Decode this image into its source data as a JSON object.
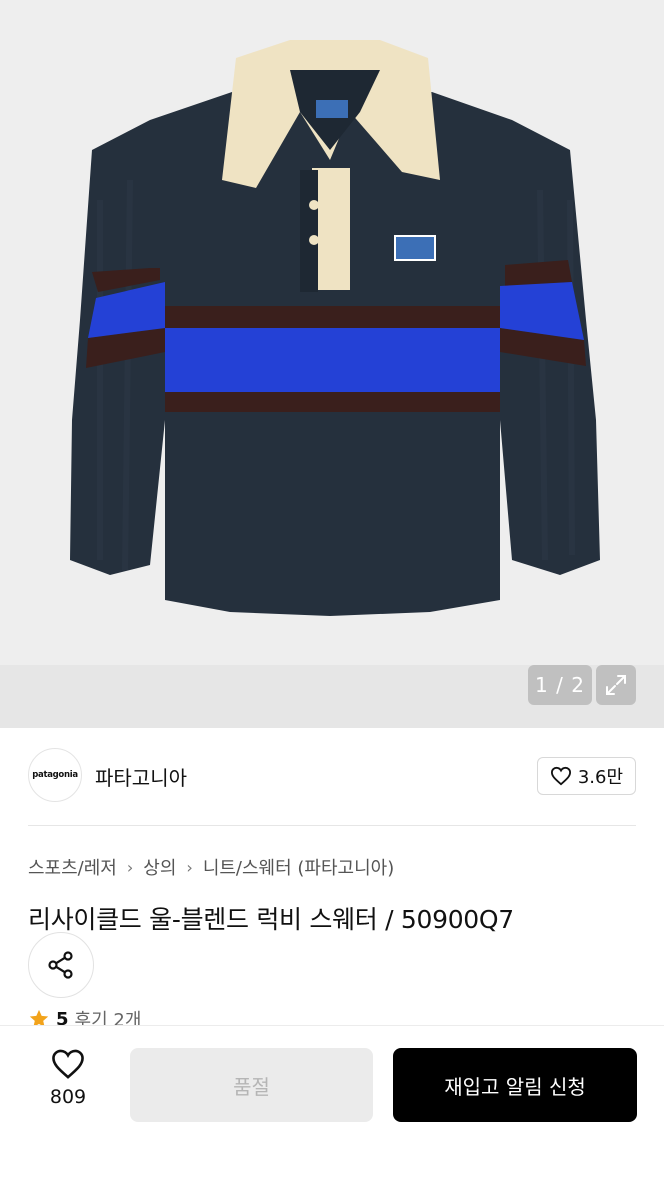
{
  "gallery": {
    "counter": "1 / 2",
    "colors": {
      "navy": "#25303d",
      "blue": "#2441d6",
      "brown": "#3a1f1c",
      "collar": "#efe3c3"
    }
  },
  "brand": {
    "logo_text": "patagonia",
    "name": "파타고니아",
    "likes": "3.6만"
  },
  "breadcrumb": {
    "level1": "스포츠/레저",
    "level2": "상의",
    "level3": "니트/스웨터 (파타고니아)"
  },
  "product": {
    "title": "리사이클드 울-블렌드 럭비 스웨터 / 50900Q7"
  },
  "rating": {
    "score": "5",
    "reviews": "후기 2개",
    "star_color": "#f2a31b"
  },
  "bottom_bar": {
    "wish_count": "809",
    "soldout_label": "품절",
    "restock_label": "재입고 알림 신청"
  }
}
